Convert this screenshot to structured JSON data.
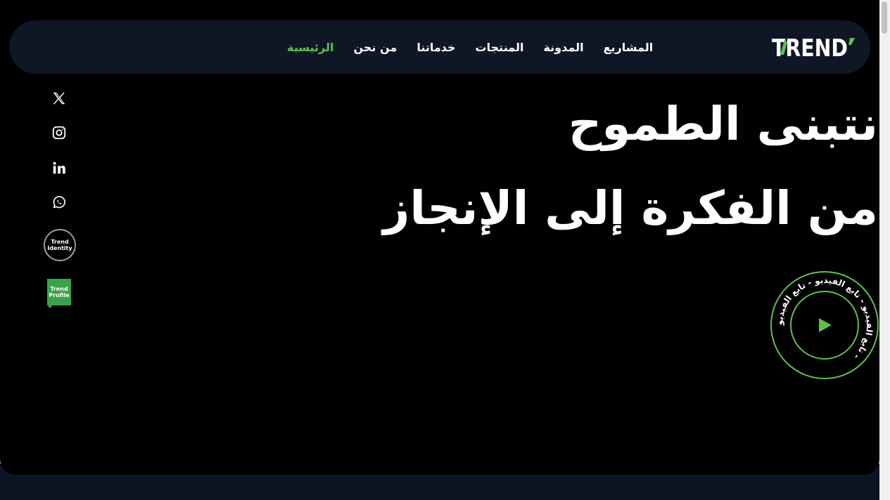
{
  "logo": {
    "text": "TREND"
  },
  "nav": {
    "items": [
      {
        "label": "الرئيسية",
        "active": true
      },
      {
        "label": "من نحن",
        "active": false
      },
      {
        "label": "خدماتنا",
        "active": false
      },
      {
        "label": "المنتجات",
        "active": false
      },
      {
        "label": "المدونة",
        "active": false
      },
      {
        "label": "المشاريع",
        "active": false
      }
    ]
  },
  "social": {
    "icons": [
      "x-icon",
      "instagram-icon",
      "linkedin-icon",
      "whatsapp-icon"
    ],
    "identity_badge": {
      "line1": "Trend",
      "line2": "Identity"
    },
    "profile_badge": {
      "line1": "Trend",
      "line2": "Profile"
    }
  },
  "hero": {
    "line1": "نتبنى الطموح",
    "line2": "من الفكرة إلى الإنجاز"
  },
  "video": {
    "ring_text": "تابع الفيديو - تابع الفيديو - تابع الفيديو - ",
    "icon": "play-icon"
  },
  "colors": {
    "accent": "#5fc04d",
    "navbar": "#0f1727",
    "background": "#000000"
  }
}
